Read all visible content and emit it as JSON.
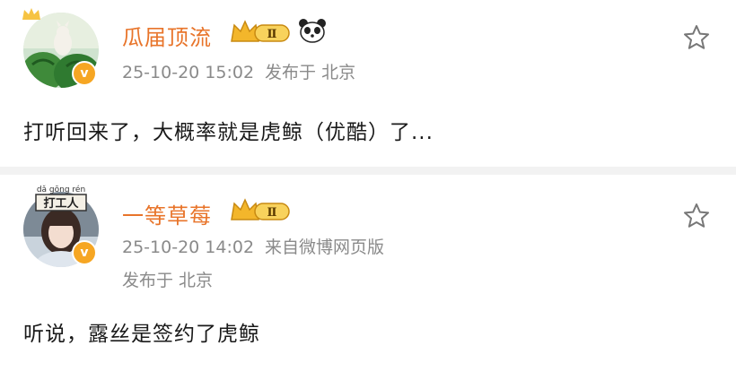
{
  "posts": [
    {
      "username": "瓜届顶流",
      "level_badge": "Ⅱ",
      "verified_mark": "v",
      "timestamp": "25-10-20 15:02",
      "location": "发布于 北京",
      "content": "打听回来了，大概率就是虎鲸（优酷）了..."
    },
    {
      "username": "一等草莓",
      "level_badge": "Ⅱ",
      "verified_mark": "v",
      "avatar_frame_pinyin": "dǎ gōng rén",
      "avatar_frame_text": "打工人",
      "timestamp": "25-10-20 14:02",
      "source": "来自微博网页版",
      "location": "发布于 北京",
      "content": "听说，露丝是签约了虎鲸"
    }
  ],
  "colors": {
    "username": "#e8742a",
    "meta": "#8a8a8a",
    "separator": "#f2f2f2",
    "badge_gold": "#f6a623"
  },
  "icons": [
    "crown-icon",
    "panda-icon",
    "star-icon",
    "verified-icon"
  ]
}
